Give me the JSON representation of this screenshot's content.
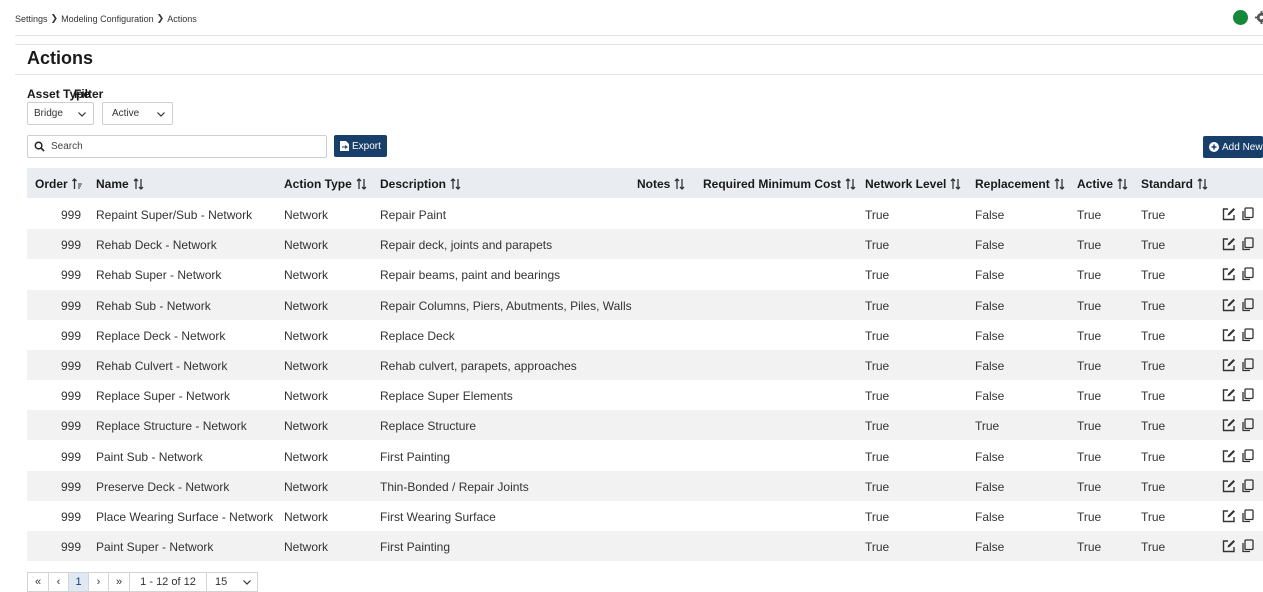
{
  "breadcrumb": [
    "Settings",
    "Modeling Configuration",
    "Actions"
  ],
  "page_title": "Actions",
  "filters": {
    "asset_type_label": "Asset Type",
    "asset_type_value": "Bridge",
    "filter_label": "Filter",
    "filter_value": "Active"
  },
  "search": {
    "placeholder": "Search"
  },
  "buttons": {
    "export": "Export",
    "add_new": "Add New"
  },
  "columns": [
    "Order",
    "Name",
    "Action Type",
    "Description",
    "Notes",
    "Required Minimum Cost",
    "Network Level",
    "Replacement",
    "Active",
    "Standard"
  ],
  "rows": [
    {
      "order": "999",
      "name": "Repaint Super/Sub - Network",
      "type": "Network",
      "description": "Repair Paint",
      "network_level": "True",
      "replacement": "False",
      "active": "True",
      "standard": "True"
    },
    {
      "order": "999",
      "name": "Rehab Deck - Network",
      "type": "Network",
      "description": "Repair deck, joints and parapets",
      "network_level": "True",
      "replacement": "False",
      "active": "True",
      "standard": "True"
    },
    {
      "order": "999",
      "name": "Rehab Super - Network",
      "type": "Network",
      "description": "Repair beams, paint and bearings",
      "network_level": "True",
      "replacement": "False",
      "active": "True",
      "standard": "True"
    },
    {
      "order": "999",
      "name": "Rehab Sub - Network",
      "type": "Network",
      "description": "Repair Columns, Piers, Abutments, Piles, Walls",
      "network_level": "True",
      "replacement": "False",
      "active": "True",
      "standard": "True"
    },
    {
      "order": "999",
      "name": "Replace Deck - Network",
      "type": "Network",
      "description": "Replace Deck",
      "network_level": "True",
      "replacement": "False",
      "active": "True",
      "standard": "True"
    },
    {
      "order": "999",
      "name": "Rehab Culvert - Network",
      "type": "Network",
      "description": "Rehab culvert, parapets, approaches",
      "network_level": "True",
      "replacement": "False",
      "active": "True",
      "standard": "True"
    },
    {
      "order": "999",
      "name": "Replace Super - Network",
      "type": "Network",
      "description": "Replace Super Elements",
      "network_level": "True",
      "replacement": "False",
      "active": "True",
      "standard": "True"
    },
    {
      "order": "999",
      "name": "Replace Structure - Network",
      "type": "Network",
      "description": "Replace Structure",
      "network_level": "True",
      "replacement": "True",
      "active": "True",
      "standard": "True"
    },
    {
      "order": "999",
      "name": "Paint Sub - Network",
      "type": "Network",
      "description": "First Painting",
      "network_level": "True",
      "replacement": "False",
      "active": "True",
      "standard": "True"
    },
    {
      "order": "999",
      "name": "Preserve Deck - Network",
      "type": "Network",
      "description": "Thin-Bonded / Repair Joints",
      "network_level": "True",
      "replacement": "False",
      "active": "True",
      "standard": "True"
    },
    {
      "order": "999",
      "name": "Place Wearing Surface - Network",
      "type": "Network",
      "description": "First Wearing Surface",
      "network_level": "True",
      "replacement": "False",
      "active": "True",
      "standard": "True"
    },
    {
      "order": "999",
      "name": "Paint Super - Network",
      "type": "Network",
      "description": "First Painting",
      "network_level": "True",
      "replacement": "False",
      "active": "True",
      "standard": "True"
    }
  ],
  "pagination": {
    "first": "«",
    "prev": "‹",
    "current_page": "1",
    "next": "›",
    "last": "»",
    "range": "1 - 12 of 12",
    "page_size": "15"
  },
  "colors": {
    "primary": "#173f6a",
    "status_online": "#16883c",
    "header_bg": "#e9edf2",
    "row_alt": "#f2f2f2"
  },
  "icons": [
    "search-icon",
    "export-file-icon",
    "add-circle-icon",
    "sort-icon",
    "edit-icon",
    "copy-icon",
    "chevron-down-icon",
    "gear-icon"
  ]
}
